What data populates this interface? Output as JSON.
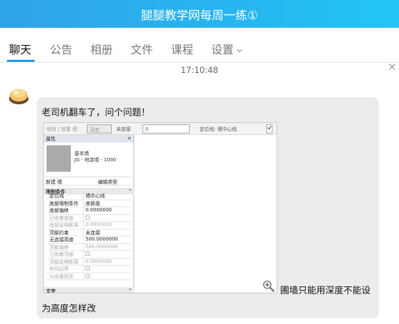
{
  "window": {
    "title": "腿腿教学网每周一练①"
  },
  "tabs": [
    {
      "label": "聊天",
      "active": true
    },
    {
      "label": "公告"
    },
    {
      "label": "相册"
    },
    {
      "label": "文件"
    },
    {
      "label": "课程"
    },
    {
      "label": "设置"
    }
  ],
  "chat": {
    "timestamp": "17:10:48",
    "message": {
      "line1": "老司机翻车了，问个问题！",
      "line2a": "圃墙只能用深度不能设",
      "line2b": "为高度怎样改"
    },
    "embedded_screenshot": {
      "toolbar": {
        "i1": "修改 | 放置 墙",
        "i2": "深度",
        "i3": "未连接",
        "i4": "0",
        "i5": "定位线: 墙中心线"
      },
      "panel": {
        "title": "属性",
        "type_name_1": "基本墙",
        "type_name_2": "JG - 地连墙 - 1000",
        "new_label": "新建 墙",
        "edit_type": "编辑类型",
        "section_constraints": "限制条件",
        "section_text": "文字",
        "props": [
          {
            "k": "定位线",
            "v": "墙中心线"
          },
          {
            "k": "底部限制条件",
            "v": "底板面"
          },
          {
            "k": "底部偏移",
            "v": "0.0000000"
          },
          {
            "k": "已附着底部",
            "v": ""
          },
          {
            "k": "底部延伸距离",
            "v": "0.0000000"
          },
          {
            "k": "顶部约束",
            "v": "未连接"
          },
          {
            "k": "无连接高度",
            "v": "500.0000000"
          },
          {
            "k": "顶部偏移",
            "v": "500.0000000"
          },
          {
            "k": "已附着顶部",
            "v": ""
          },
          {
            "k": "顶部延伸距离",
            "v": "0.0000000"
          },
          {
            "k": "房间边界",
            "v": ""
          },
          {
            "k": "与体量相关",
            "v": ""
          }
        ]
      }
    }
  },
  "colors": {
    "titlebar_start": "#2fa3e8",
    "titlebar_end": "#22c6f4",
    "accent": "#1f9bf0",
    "bubble": "#ececec"
  }
}
